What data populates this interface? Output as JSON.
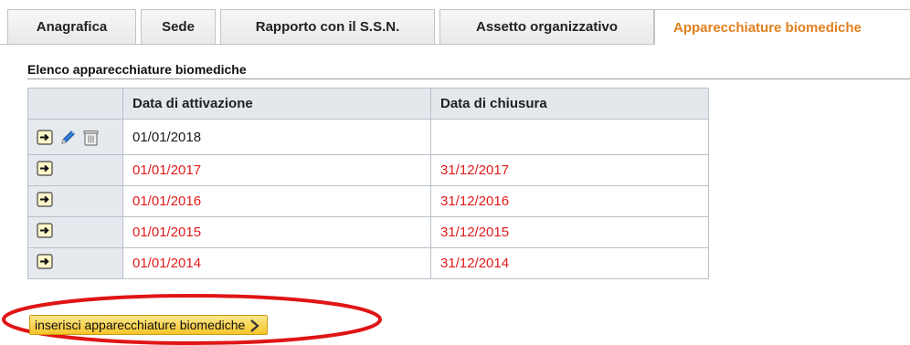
{
  "tabs": [
    {
      "label": "Anagrafica",
      "active": false
    },
    {
      "label": "Sede",
      "active": false
    },
    {
      "label": "Rapporto con il S.S.N.",
      "active": false
    },
    {
      "label": "Assetto organizzativo",
      "active": false
    },
    {
      "label": "Apparecchiature biomediche",
      "active": true
    }
  ],
  "section": {
    "title": "Elenco apparecchiature biomediche"
  },
  "table": {
    "columns": [
      "",
      "Data di attivazione",
      "Data di chiusura"
    ],
    "rows": [
      {
        "icons": [
          "detail-icon",
          "edit-pencil-icon",
          "delete-trash-icon"
        ],
        "activation": "01/01/2018",
        "closure": "",
        "closed": false
      },
      {
        "icons": [
          "detail-icon"
        ],
        "activation": "01/01/2017",
        "closure": "31/12/2017",
        "closed": true
      },
      {
        "icons": [
          "detail-icon"
        ],
        "activation": "01/01/2016",
        "closure": "31/12/2016",
        "closed": true
      },
      {
        "icons": [
          "detail-icon"
        ],
        "activation": "01/01/2015",
        "closure": "31/12/2015",
        "closed": true
      },
      {
        "icons": [
          "detail-icon"
        ],
        "activation": "01/01/2014",
        "closure": "31/12/2014",
        "closed": true
      }
    ]
  },
  "insert_button": {
    "label": "inserisci apparecchiature biomediche",
    "icon": "chevron-right-icon"
  },
  "colors": {
    "active_tab": "#e0801e",
    "closed_row_text": "#e21b1b",
    "button_bg": "#f5c52b",
    "annotation": "#e01515"
  }
}
